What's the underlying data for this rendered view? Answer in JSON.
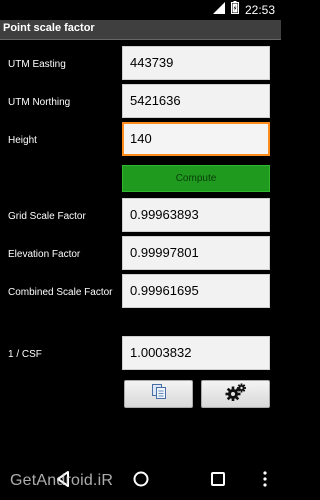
{
  "status_bar": {
    "time": "22:53"
  },
  "title": "Point scale factor",
  "rows": [
    {
      "label": "UTM Easting",
      "value": "443739"
    },
    {
      "label": "UTM Northing",
      "value": "5421636"
    },
    {
      "label": "Height",
      "value": "140"
    }
  ],
  "compute_label": "Compute",
  "results": [
    {
      "label": "Grid Scale Factor",
      "value": "0.99963893"
    },
    {
      "label": "Elevation Factor",
      "value": "0.99997801"
    },
    {
      "label": "Combined Scale Factor",
      "value": "0.99961695"
    },
    {
      "label": "1 / CSF",
      "value": "1.0003832"
    }
  ],
  "toolbar": {
    "copy_icon": "copy-icon",
    "settings_icon": "gear-icon"
  },
  "watermark": "GetAndroid.iR",
  "colors": {
    "title_bar": "#3f3f3f",
    "compute_button": "#1f9a1f",
    "focus_border": "#ff8c1a"
  }
}
